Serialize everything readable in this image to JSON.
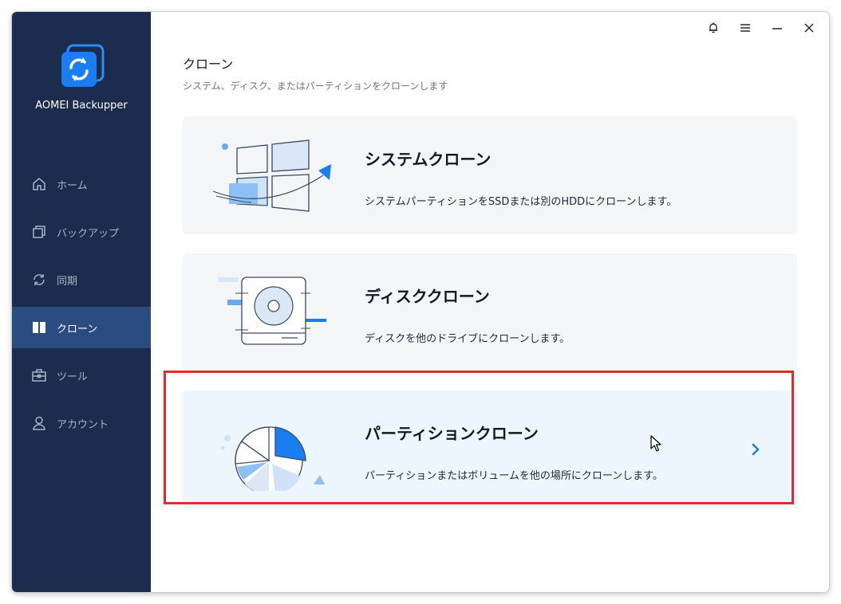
{
  "app": {
    "name": "AOMEI Backupper"
  },
  "sidebar": {
    "items": [
      {
        "label": "ホーム",
        "icon": "home-icon",
        "active": false
      },
      {
        "label": "バックアップ",
        "icon": "backup-icon",
        "active": false
      },
      {
        "label": "同期",
        "icon": "sync-icon",
        "active": false
      },
      {
        "label": "クローン",
        "icon": "clone-icon",
        "active": true
      },
      {
        "label": "ツール",
        "icon": "tools-icon",
        "active": false
      },
      {
        "label": "アカウント",
        "icon": "account-icon",
        "active": false
      }
    ]
  },
  "window_controls": [
    "bell-icon",
    "menu-icon",
    "minimize-icon",
    "close-icon"
  ],
  "main": {
    "title": "クローン",
    "subtitle": "システム、ディスク、またはパーティションをクローンします",
    "cards": [
      {
        "title": "システムクローン",
        "description": "システムパーティションをSSDまたは別のHDDにクローンします。",
        "icon": "system-clone-illustration"
      },
      {
        "title": "ディスククローン",
        "description": "ディスクを他のドライブにクローンします。",
        "icon": "disk-clone-illustration"
      },
      {
        "title": "パーティションクローン",
        "description": "パーティションまたはボリュームを他の場所にクローンします。",
        "icon": "partition-clone-illustration",
        "selected": true
      }
    ]
  },
  "colors": {
    "sidebar_bg": "#1b2c4e",
    "sidebar_active": "#2a4c80",
    "accent": "#1a7ef2",
    "highlight": "#e52a2a"
  }
}
